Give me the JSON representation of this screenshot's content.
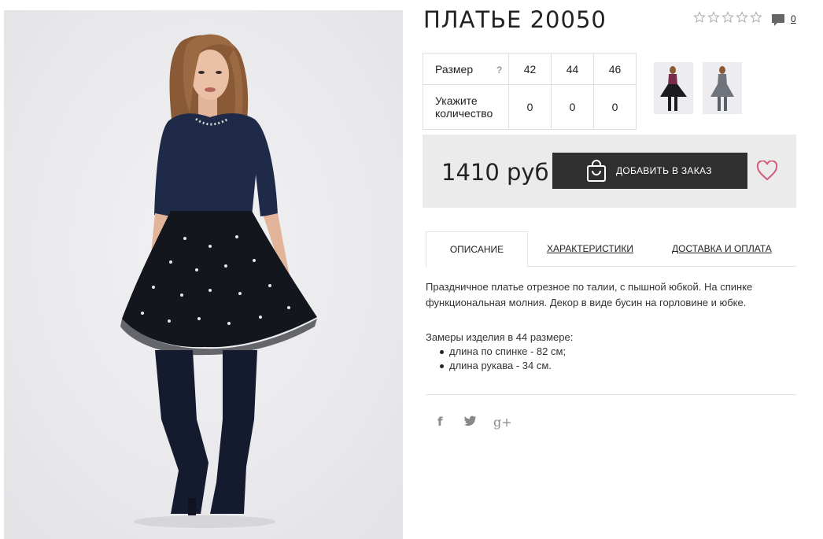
{
  "product": {
    "title": "ПЛАТЬЕ 20050",
    "rating_stars": 0,
    "comment_count": "0",
    "price": "1410 руб"
  },
  "icons": {
    "star": "star-outline-icon",
    "comment": "comment-icon",
    "bag": "shopping-bag-icon",
    "heart": "heart-icon",
    "facebook": "facebook-icon",
    "twitter": "twitter-icon",
    "google_plus": "google-plus-icon"
  },
  "size_table": {
    "size_label": "Размер",
    "help": "?",
    "sizes": [
      "42",
      "44",
      "46"
    ],
    "quantity_label": "Укажите количество",
    "quantities": [
      "0",
      "0",
      "0"
    ]
  },
  "buttons": {
    "add_to_order": "ДОБАВИТЬ В ЗАКАЗ"
  },
  "tabs": {
    "description": "ОПИСАНИЕ",
    "characteristics": "ХАРАКТЕРИСТИКИ",
    "delivery": "ДОСТАВКА И ОПЛАТА"
  },
  "description": {
    "text": "Праздничное платье отрезное по талии, с пышной юбкой. На спинке функциональная молния. Декор в виде бусин на горловине и юбке.",
    "measures_title": "Замеры изделия в 44 размере:",
    "measures": [
      "длина по спинке - 82 см;",
      "длина рукава - 34 см."
    ]
  },
  "social": {
    "facebook": "f",
    "google_plus": "g+"
  },
  "colors": {
    "dress_navy": "#1e2a48",
    "skirt_black": "#14161d",
    "button_bg": "#2f2f2f",
    "price_box_bg": "#ebebeb",
    "heart": "#d45a78",
    "thumb1_dress": "#7a2a4a",
    "thumb2_dress": "#6f747c"
  }
}
